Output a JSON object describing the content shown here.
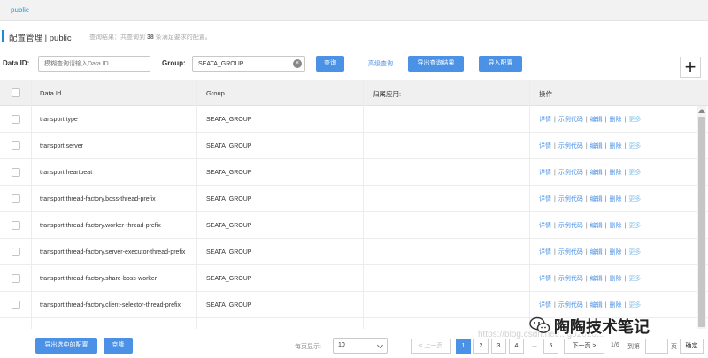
{
  "namespace_tab": "public",
  "header": {
    "title": "配置管理 | public",
    "hint_prefix": "查询结果：共查询到",
    "hint_count": "38",
    "hint_suffix": "条满足要求的配置。"
  },
  "filters": {
    "data_id_label": "Data ID:",
    "data_id_placeholder": "模糊查询请输入Data ID",
    "group_label": "Group:",
    "group_value": "SEATA_GROUP",
    "query_button": "查询",
    "advanced_query": "高级查询",
    "export_query_button": "导出查询结果",
    "import_button": "导入配置",
    "add_button": "+"
  },
  "table": {
    "columns": [
      "Data Id",
      "Group",
      "归属应用:",
      "操作"
    ],
    "rows": [
      {
        "data_id": "transport.type",
        "group": "SEATA_GROUP"
      },
      {
        "data_id": "transport.server",
        "group": "SEATA_GROUP"
      },
      {
        "data_id": "transport.heartbeat",
        "group": "SEATA_GROUP"
      },
      {
        "data_id": "transport.thread-factory.boss-thread-prefix",
        "group": "SEATA_GROUP"
      },
      {
        "data_id": "transport.thread-factory.worker-thread-prefix",
        "group": "SEATA_GROUP"
      },
      {
        "data_id": "transport.thread-factory.server-executor-thread-prefix",
        "group": "SEATA_GROUP"
      },
      {
        "data_id": "transport.thread-factory.share-boss-worker",
        "group": "SEATA_GROUP"
      },
      {
        "data_id": "transport.thread-factory.client-selector-thread-prefix",
        "group": "SEATA_GROUP"
      }
    ],
    "actions": [
      "详情",
      "示例代码",
      "编辑",
      "删除",
      "更多"
    ]
  },
  "footer": {
    "export_selected_button": "导出选中的配置",
    "clone_button": "克隆",
    "page_size_label": "每页显示:",
    "page_size_value": "10",
    "prev_label": "< 上一页",
    "pages": [
      "1",
      "2",
      "3",
      "4"
    ],
    "ellipsis": "...",
    "last_page": "5",
    "next_label": "下一页 >",
    "total_pages": "1/6",
    "goto_label": "到第",
    "page_unit": "页",
    "confirm_button": "确定"
  },
  "overlay": {
    "brand": "陶陶技术笔记",
    "watermark": "https://blog.csdn.net/...g02020..."
  }
}
